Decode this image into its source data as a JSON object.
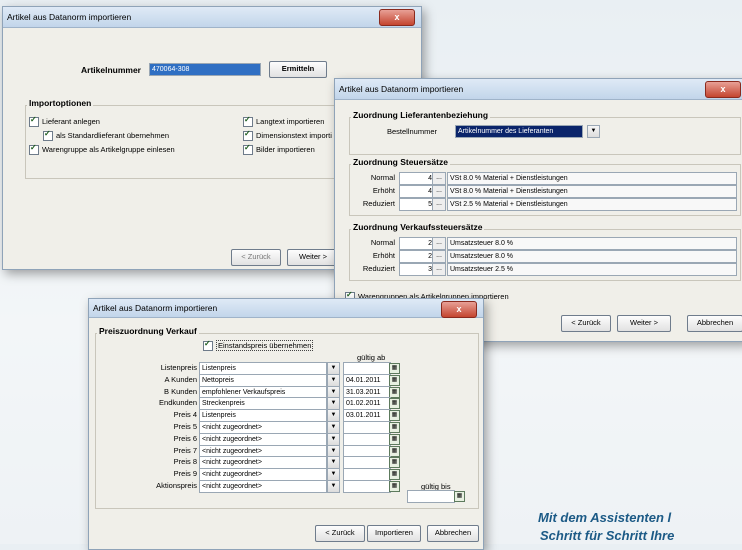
{
  "win1": {
    "title": "Artikel aus Datanorm importieren",
    "close": "x",
    "artnr_label": "Artikelnummer",
    "artnr_value": "470064-308",
    "ermitteln": "Ermitteln",
    "group": "Importoptionen",
    "opt_lieferant": "Lieferant anlegen",
    "opt_standard": "als Standardlieferant übernehmen",
    "opt_warengruppe": "Warengruppe als Artikelgruppe einlesen",
    "opt_langtext": "Langtext importieren",
    "opt_dimension": "Dimensionstext importi",
    "opt_bilder": "Bilder importieren",
    "back": "< Zurück",
    "next": "Weiter >"
  },
  "win2": {
    "title": "Artikel aus Datanorm importieren",
    "close": "x",
    "g1": "Zuordnung Lieferantenbeziehung",
    "bestell_label": "Bestellnummer",
    "bestell_value": "Artikelnummer des Lieferanten",
    "g2": "Zuordnung Steuersätze",
    "steuer": [
      {
        "l": "Normal",
        "n": "4",
        "t": "VSt 8.0 % Material + Dienstleistungen"
      },
      {
        "l": "Erhöht",
        "n": "4",
        "t": "VSt 8.0 % Material + Dienstleistungen"
      },
      {
        "l": "Reduziert",
        "n": "5",
        "t": "VSt 2.5 % Material + Dienstleistungen"
      }
    ],
    "g3": "Zuordnung Verkaufssteuersätze",
    "vk": [
      {
        "l": "Normal",
        "n": "2",
        "t": "Umsatzsteuer 8.0 %"
      },
      {
        "l": "Erhöht",
        "n": "2",
        "t": "Umsatzsteuer 8.0 %"
      },
      {
        "l": "Reduziert",
        "n": "3",
        "t": "Umsatzsteuer 2.5 %"
      }
    ],
    "chk": "Warengruppen als Artikelgruppen importieren",
    "back": "< Zurück",
    "next": "Weiter >",
    "cancel": "Abbrechen"
  },
  "win3": {
    "title": "Artikel aus Datanorm importieren",
    "close": "x",
    "group": "Preiszuordnung Verkauf",
    "einstand": "Einstandspreis übernehmen",
    "gueltig_ab": "gültig ab",
    "gueltig_bis": "gültig bis",
    "rows": [
      {
        "l": "Listenpreis",
        "v": "Listenpreis",
        "d": ""
      },
      {
        "l": "A Kunden",
        "v": "Nettopreis",
        "d": "04.01.2011"
      },
      {
        "l": "B Kunden",
        "v": "empfohlener Verkaufspreis",
        "d": "31.03.2011"
      },
      {
        "l": "Endkunden",
        "v": "Streckenpreis",
        "d": "01.02.2011"
      },
      {
        "l": "Preis 4",
        "v": "Listenpreis",
        "d": "03.01.2011"
      },
      {
        "l": "Preis 5",
        "v": "<nicht zugeordnet>",
        "d": ""
      },
      {
        "l": "Preis 6",
        "v": "<nicht zugeordnet>",
        "d": ""
      },
      {
        "l": "Preis 7",
        "v": "<nicht zugeordnet>",
        "d": ""
      },
      {
        "l": "Preis 8",
        "v": "<nicht zugeordnet>",
        "d": ""
      },
      {
        "l": "Preis 9",
        "v": "<nicht zugeordnet>",
        "d": ""
      },
      {
        "l": "Aktionspreis",
        "v": "<nicht zugeordnet>",
        "d": ""
      }
    ],
    "back": "< Zurück",
    "import": "Importieren",
    "cancel": "Abbrechen"
  },
  "caption": {
    "line1": "Mit dem Assistenten l",
    "line2": "Schritt für Schritt Ihre"
  }
}
